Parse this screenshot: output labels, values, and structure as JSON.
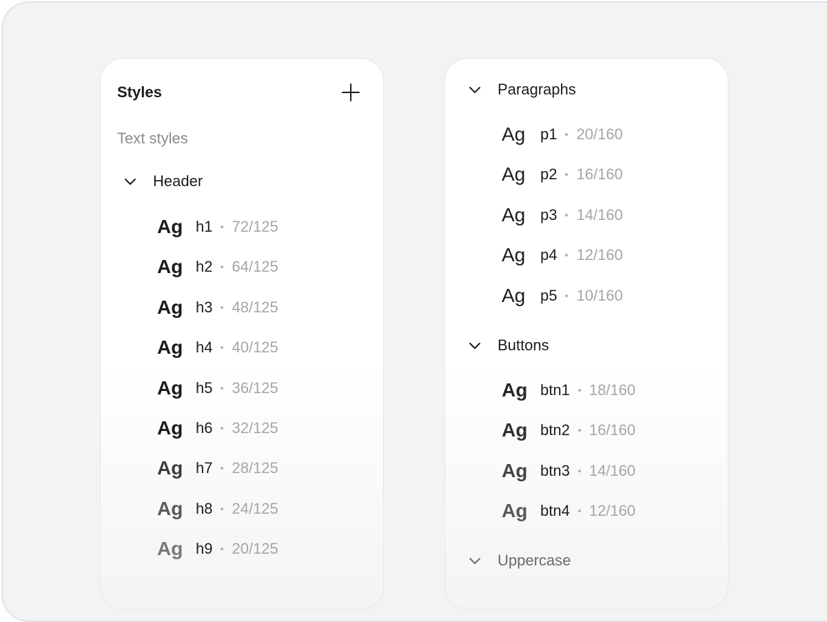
{
  "styles_panel": {
    "title": "Styles",
    "section_label": "Text styles",
    "header_group": {
      "label": "Header",
      "items": [
        {
          "sample": "Ag",
          "name": "h1",
          "meta": "72/125"
        },
        {
          "sample": "Ag",
          "name": "h2",
          "meta": "64/125"
        },
        {
          "sample": "Ag",
          "name": "h3",
          "meta": "48/125"
        },
        {
          "sample": "Ag",
          "name": "h4",
          "meta": "40/125"
        },
        {
          "sample": "Ag",
          "name": "h5",
          "meta": "36/125"
        },
        {
          "sample": "Ag",
          "name": "h6",
          "meta": "32/125"
        },
        {
          "sample": "Ag",
          "name": "h7",
          "meta": "28/125"
        },
        {
          "sample": "Ag",
          "name": "h8",
          "meta": "24/125"
        },
        {
          "sample": "Ag",
          "name": "h9",
          "meta": "20/125"
        }
      ]
    }
  },
  "right_panel": {
    "paragraphs_group": {
      "label": "Paragraphs",
      "items": [
        {
          "sample": "Ag",
          "name": "p1",
          "meta": "20/160"
        },
        {
          "sample": "Ag",
          "name": "p2",
          "meta": "16/160"
        },
        {
          "sample": "Ag",
          "name": "p3",
          "meta": "14/160"
        },
        {
          "sample": "Ag",
          "name": "p4",
          "meta": "12/160"
        },
        {
          "sample": "Ag",
          "name": "p5",
          "meta": "10/160"
        }
      ]
    },
    "buttons_group": {
      "label": "Buttons",
      "items": [
        {
          "sample": "Ag",
          "name": "btn1",
          "meta": "18/160"
        },
        {
          "sample": "Ag",
          "name": "btn2",
          "meta": "16/160"
        },
        {
          "sample": "Ag",
          "name": "btn3",
          "meta": "14/160"
        },
        {
          "sample": "Ag",
          "name": "btn4",
          "meta": "12/160"
        }
      ]
    },
    "uppercase_group": {
      "label": "Uppercase"
    }
  },
  "colors": {
    "text_primary": "#1c1c1e",
    "text_secondary": "#8a8a8f",
    "text_meta": "#a4a4ab",
    "background": "#f3f3f4",
    "panel": "#ffffff"
  },
  "icons": {
    "add": "plus-icon",
    "expand": "chevron-down-icon"
  }
}
